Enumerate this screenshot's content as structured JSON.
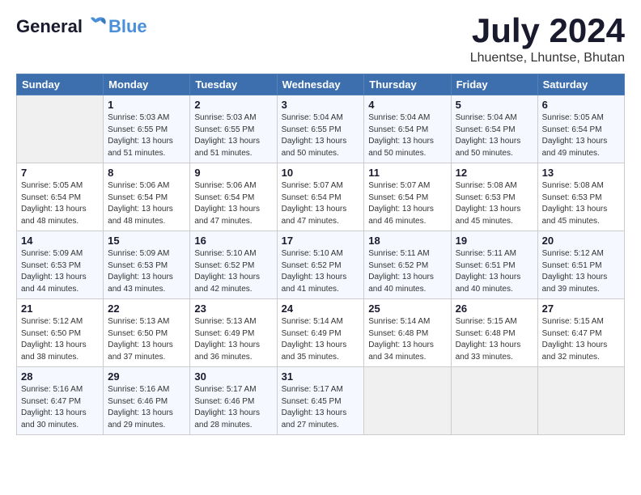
{
  "header": {
    "logo_line1": "General",
    "logo_line2": "Blue",
    "month_year": "July 2024",
    "location": "Lhuentse, Lhuntse, Bhutan"
  },
  "weekdays": [
    "Sunday",
    "Monday",
    "Tuesday",
    "Wednesday",
    "Thursday",
    "Friday",
    "Saturday"
  ],
  "weeks": [
    [
      {
        "day": "",
        "info": ""
      },
      {
        "day": "1",
        "info": "Sunrise: 5:03 AM\nSunset: 6:55 PM\nDaylight: 13 hours\nand 51 minutes."
      },
      {
        "day": "2",
        "info": "Sunrise: 5:03 AM\nSunset: 6:55 PM\nDaylight: 13 hours\nand 51 minutes."
      },
      {
        "day": "3",
        "info": "Sunrise: 5:04 AM\nSunset: 6:55 PM\nDaylight: 13 hours\nand 50 minutes."
      },
      {
        "day": "4",
        "info": "Sunrise: 5:04 AM\nSunset: 6:54 PM\nDaylight: 13 hours\nand 50 minutes."
      },
      {
        "day": "5",
        "info": "Sunrise: 5:04 AM\nSunset: 6:54 PM\nDaylight: 13 hours\nand 50 minutes."
      },
      {
        "day": "6",
        "info": "Sunrise: 5:05 AM\nSunset: 6:54 PM\nDaylight: 13 hours\nand 49 minutes."
      }
    ],
    [
      {
        "day": "7",
        "info": "Sunrise: 5:05 AM\nSunset: 6:54 PM\nDaylight: 13 hours\nand 48 minutes."
      },
      {
        "day": "8",
        "info": "Sunrise: 5:06 AM\nSunset: 6:54 PM\nDaylight: 13 hours\nand 48 minutes."
      },
      {
        "day": "9",
        "info": "Sunrise: 5:06 AM\nSunset: 6:54 PM\nDaylight: 13 hours\nand 47 minutes."
      },
      {
        "day": "10",
        "info": "Sunrise: 5:07 AM\nSunset: 6:54 PM\nDaylight: 13 hours\nand 47 minutes."
      },
      {
        "day": "11",
        "info": "Sunrise: 5:07 AM\nSunset: 6:54 PM\nDaylight: 13 hours\nand 46 minutes."
      },
      {
        "day": "12",
        "info": "Sunrise: 5:08 AM\nSunset: 6:53 PM\nDaylight: 13 hours\nand 45 minutes."
      },
      {
        "day": "13",
        "info": "Sunrise: 5:08 AM\nSunset: 6:53 PM\nDaylight: 13 hours\nand 45 minutes."
      }
    ],
    [
      {
        "day": "14",
        "info": "Sunrise: 5:09 AM\nSunset: 6:53 PM\nDaylight: 13 hours\nand 44 minutes."
      },
      {
        "day": "15",
        "info": "Sunrise: 5:09 AM\nSunset: 6:53 PM\nDaylight: 13 hours\nand 43 minutes."
      },
      {
        "day": "16",
        "info": "Sunrise: 5:10 AM\nSunset: 6:52 PM\nDaylight: 13 hours\nand 42 minutes."
      },
      {
        "day": "17",
        "info": "Sunrise: 5:10 AM\nSunset: 6:52 PM\nDaylight: 13 hours\nand 41 minutes."
      },
      {
        "day": "18",
        "info": "Sunrise: 5:11 AM\nSunset: 6:52 PM\nDaylight: 13 hours\nand 40 minutes."
      },
      {
        "day": "19",
        "info": "Sunrise: 5:11 AM\nSunset: 6:51 PM\nDaylight: 13 hours\nand 40 minutes."
      },
      {
        "day": "20",
        "info": "Sunrise: 5:12 AM\nSunset: 6:51 PM\nDaylight: 13 hours\nand 39 minutes."
      }
    ],
    [
      {
        "day": "21",
        "info": "Sunrise: 5:12 AM\nSunset: 6:50 PM\nDaylight: 13 hours\nand 38 minutes."
      },
      {
        "day": "22",
        "info": "Sunrise: 5:13 AM\nSunset: 6:50 PM\nDaylight: 13 hours\nand 37 minutes."
      },
      {
        "day": "23",
        "info": "Sunrise: 5:13 AM\nSunset: 6:49 PM\nDaylight: 13 hours\nand 36 minutes."
      },
      {
        "day": "24",
        "info": "Sunrise: 5:14 AM\nSunset: 6:49 PM\nDaylight: 13 hours\nand 35 minutes."
      },
      {
        "day": "25",
        "info": "Sunrise: 5:14 AM\nSunset: 6:48 PM\nDaylight: 13 hours\nand 34 minutes."
      },
      {
        "day": "26",
        "info": "Sunrise: 5:15 AM\nSunset: 6:48 PM\nDaylight: 13 hours\nand 33 minutes."
      },
      {
        "day": "27",
        "info": "Sunrise: 5:15 AM\nSunset: 6:47 PM\nDaylight: 13 hours\nand 32 minutes."
      }
    ],
    [
      {
        "day": "28",
        "info": "Sunrise: 5:16 AM\nSunset: 6:47 PM\nDaylight: 13 hours\nand 30 minutes."
      },
      {
        "day": "29",
        "info": "Sunrise: 5:16 AM\nSunset: 6:46 PM\nDaylight: 13 hours\nand 29 minutes."
      },
      {
        "day": "30",
        "info": "Sunrise: 5:17 AM\nSunset: 6:46 PM\nDaylight: 13 hours\nand 28 minutes."
      },
      {
        "day": "31",
        "info": "Sunrise: 5:17 AM\nSunset: 6:45 PM\nDaylight: 13 hours\nand 27 minutes."
      },
      {
        "day": "",
        "info": ""
      },
      {
        "day": "",
        "info": ""
      },
      {
        "day": "",
        "info": ""
      }
    ]
  ]
}
